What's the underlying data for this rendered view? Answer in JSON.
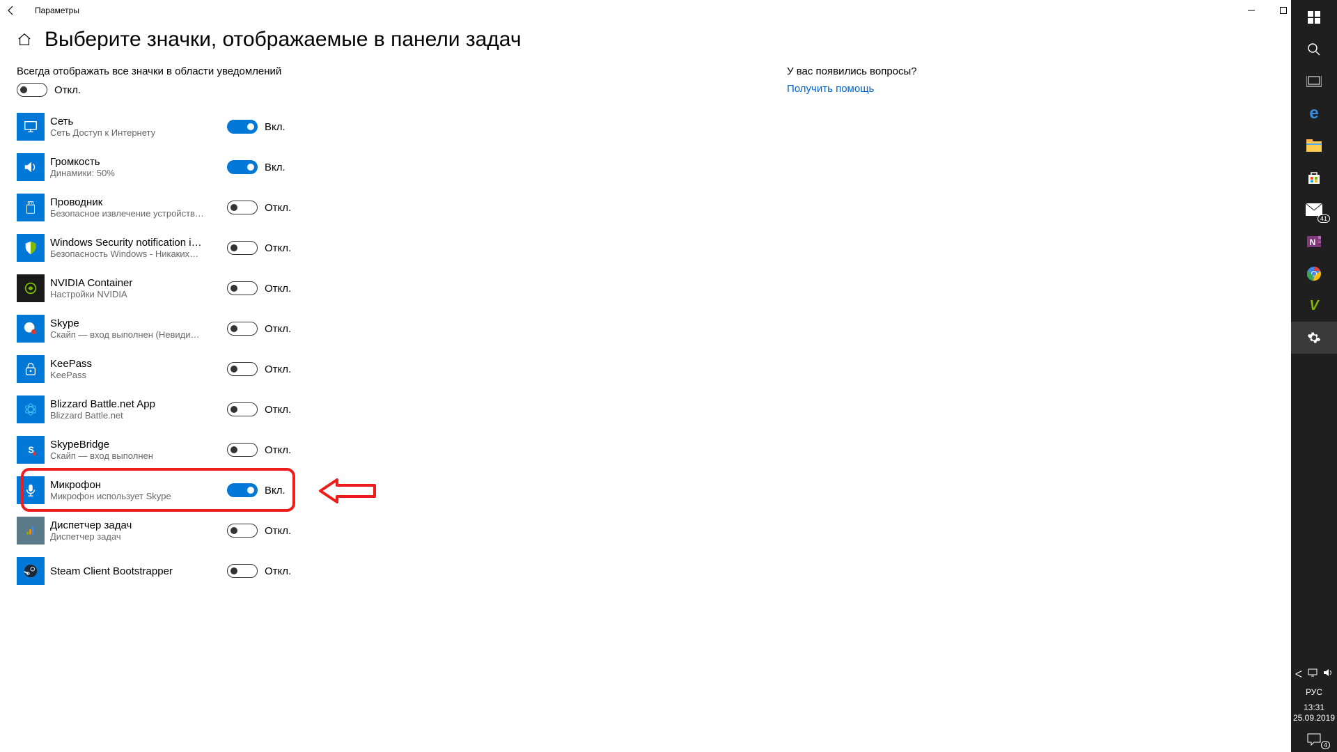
{
  "window": {
    "title": "Параметры"
  },
  "page": {
    "heading": "Выберите значки, отображаемые в панели задач",
    "always_label": "Всегда отображать все значки в области уведомлений",
    "always_state": "Откл.",
    "on_label": "Вкл.",
    "off_label": "Откл."
  },
  "items": [
    {
      "title": "Сеть",
      "sub": "Сеть Доступ к Интернету",
      "on": true,
      "icon": "monitor"
    },
    {
      "title": "Громкость",
      "sub": "Динамики: 50%",
      "on": true,
      "icon": "volume"
    },
    {
      "title": "Проводник",
      "sub": "Безопасное извлечение устройств…",
      "on": false,
      "icon": "usb"
    },
    {
      "title": "Windows Security notification icon",
      "sub": "Безопасность Windows - Никаких…",
      "on": false,
      "icon": "shield"
    },
    {
      "title": "NVIDIA Container",
      "sub": "Настройки NVIDIA",
      "on": false,
      "icon": "nvidia"
    },
    {
      "title": "Skype",
      "sub": "Скайп — вход выполнен (Невиди…",
      "on": false,
      "icon": "skype"
    },
    {
      "title": "KeePass",
      "sub": "KeePass",
      "on": false,
      "icon": "lock"
    },
    {
      "title": "Blizzard Battle.net App",
      "sub": "Blizzard Battle.net",
      "on": false,
      "icon": "battlenet"
    },
    {
      "title": "SkypeBridge",
      "sub": "Скайп — вход выполнен",
      "on": false,
      "icon": "skypebridge"
    },
    {
      "title": "Микрофон",
      "sub": "Микрофон использует Skype",
      "on": true,
      "icon": "mic",
      "highlight": true
    },
    {
      "title": "Диспетчер задач",
      "sub": "Диспетчер задач",
      "on": false,
      "icon": "tm"
    },
    {
      "title": "Steam Client Bootstrapper",
      "sub": "",
      "on": false,
      "icon": "steam"
    }
  ],
  "sidebar": {
    "help_title": "У вас появились вопросы?",
    "help_link": "Получить помощь"
  },
  "taskbar": {
    "lang": "РУС",
    "time": "13:31",
    "date": "25.09.2019",
    "mail_badge": "41",
    "notif_badge": "4"
  }
}
